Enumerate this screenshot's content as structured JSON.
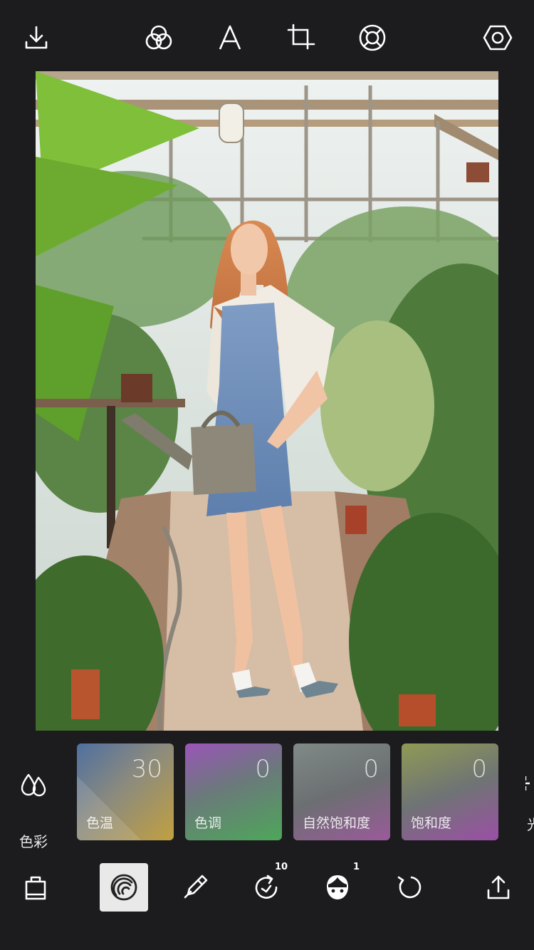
{
  "topbar": {
    "icons": [
      "download-icon",
      "filters-icon",
      "text-icon",
      "crop-icon",
      "lifebuoy-icon",
      "settings-icon"
    ]
  },
  "adjust": {
    "category": {
      "icon": "color-drops-icon",
      "label": "色彩"
    },
    "tiles": [
      {
        "label": "色温",
        "value": "30"
      },
      {
        "label": "色调",
        "value": "0"
      },
      {
        "label": "自然饱和度",
        "value": "0"
      },
      {
        "label": "饱和度",
        "value": "0"
      }
    ],
    "next_category_partial_label": "光"
  },
  "bottombar": {
    "icons": [
      "shop-bag-icon",
      "adjust-icon",
      "eraser-icon",
      "history-icon",
      "face-icon",
      "undo-icon",
      "export-icon"
    ],
    "history_badge": "10",
    "face_badge": "1"
  },
  "colors": {
    "background": "#1c1c1e",
    "icon": "#ffffff",
    "active_button": "#e9e9e9"
  }
}
